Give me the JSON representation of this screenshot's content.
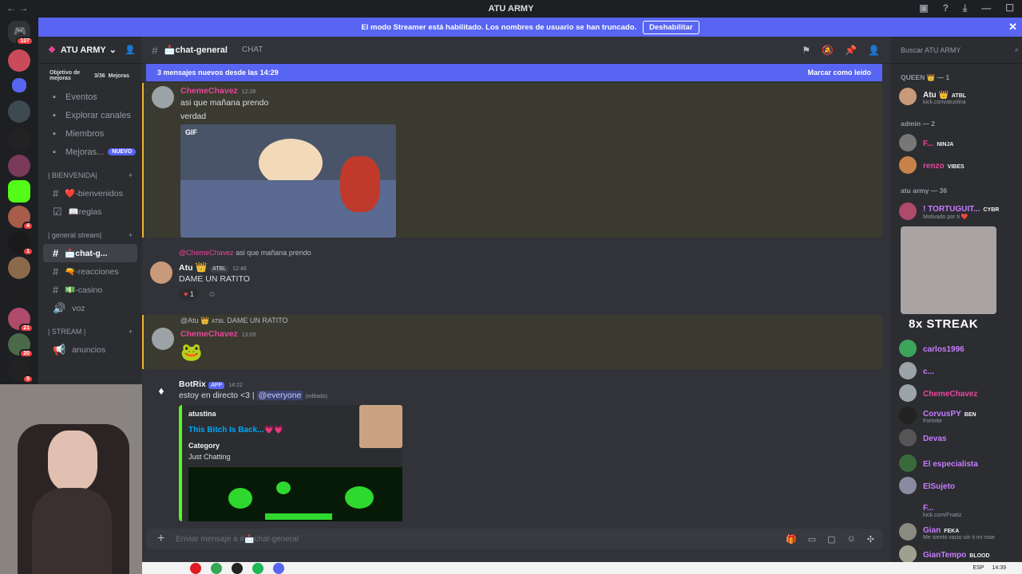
{
  "window": {
    "title": "ATU ARMY"
  },
  "streamer_banner": {
    "text": "El modo Streamer está habilitado. Los nombres de usuario se han truncado.",
    "button": "Deshabilitar"
  },
  "guild_badges": [
    "107",
    "4",
    "1",
    "21",
    "20",
    "5"
  ],
  "server": {
    "name": "ATU ARMY"
  },
  "boost": {
    "label": "Objetivo de mejoras",
    "count": "3/36",
    "unit": "Mejoras"
  },
  "nav": [
    {
      "icon": "calendar-icon",
      "label": "Eventos"
    },
    {
      "icon": "compass-icon",
      "label": "Explorar canales"
    },
    {
      "icon": "members-icon",
      "label": "Miembros"
    },
    {
      "icon": "boost-icon",
      "label": "Mejoras...",
      "badge": "NUEVO"
    }
  ],
  "categories": [
    {
      "name": "| BIENVENIDA|",
      "channels": [
        {
          "prefix": "#",
          "name": "❤️-bienvenidos"
        },
        {
          "prefix": "☑",
          "name": "📖reglas"
        }
      ]
    },
    {
      "name": "| general stream|",
      "channels": [
        {
          "prefix": "#",
          "name": "📩chat-g...",
          "active": true
        },
        {
          "prefix": "#",
          "name": "🔫-reacciones"
        },
        {
          "prefix": "#",
          "name": "💵-casino"
        },
        {
          "prefix": "🔊",
          "name": "voz"
        }
      ]
    },
    {
      "name": "| STREAM |",
      "channels": [
        {
          "prefix": "📢",
          "name": "anuncios"
        }
      ]
    }
  ],
  "chat": {
    "channel": "📩chat-general",
    "topic": "CHAT",
    "new_messages": "3 mensajes nuevos desde las 14:29",
    "mark_read": "Marcar como leído",
    "gif_label": "GIF",
    "composer_placeholder": "Enviar mensaje a #📩chat-general"
  },
  "messages": [
    {
      "author": "ChemeChavez",
      "time": "12:28",
      "lines": [
        "asi que mañana prendo",
        "verdad"
      ]
    },
    {
      "reply_author": "@ChemeChavez",
      "reply_text": "asi que mañana prendo",
      "author": "Atu",
      "tag": "ATBL",
      "time": "12:48",
      "lines": [
        "DAME UN RATITO"
      ],
      "reaction": "1"
    },
    {
      "reply_author": "@Atu",
      "reply_tag": "ATBL",
      "reply_text": "DAME UN RATITO",
      "author": "ChemeChavez",
      "time": "13:09"
    },
    {
      "author": "BotRix",
      "app_tag": "APP",
      "time": "14:22",
      "text": "estoy en directo <3 |",
      "mention": "@everyone",
      "edited": "(editado)"
    }
  ],
  "embed": {
    "author": "atustina",
    "title": "This Bitch Is Back...💗💗",
    "field_name": "Category",
    "field_value": "Just Chatting"
  },
  "members": {
    "search_placeholder": "Buscar ATU ARMY",
    "groups": [
      {
        "label": "QUEEN 👑 — 1"
      },
      {
        "label": "admin — 2"
      },
      {
        "label": "atu army — 36"
      }
    ],
    "list": [
      {
        "name": "Atu 👑",
        "tag": "ATBL",
        "sub": "kick.com/atustina",
        "color": "#f2f3f5"
      },
      {
        "name": "F...",
        "tag": "NINJA",
        "color": "#eb459e"
      },
      {
        "name": "renzo",
        "tag": "VIBES",
        "color": "#eb459e"
      },
      {
        "name": "! TORTUGUIT...",
        "tag": "CYBR",
        "sub": "Motivado por ti ❤️",
        "color": "#c77dff"
      },
      {
        "name": "carlos1996",
        "color": "#c77dff"
      },
      {
        "name": "c...",
        "color": "#c77dff"
      },
      {
        "name": "ChemeChavez",
        "color": "#eb459e"
      },
      {
        "name": "CorvusPY",
        "tag": "BEN",
        "sub": "Fortnite",
        "color": "#c77dff"
      },
      {
        "name": "Devas",
        "color": "#c77dff"
      },
      {
        "name": "El especialista",
        "color": "#c77dff"
      },
      {
        "name": "ElSujeto",
        "color": "#c77dff"
      },
      {
        "name": "F...",
        "sub": "kick.com/Fnatiz",
        "color": "#c77dff"
      },
      {
        "name": "Gian",
        "tag": "FEKA",
        "sub": "Me siento vacio sin ti mi rose",
        "color": "#c77dff"
      },
      {
        "name": "GianTempo",
        "tag": "BLOOD",
        "color": "#c77dff"
      }
    ],
    "overlay": "8x STREAK"
  },
  "taskbar": {
    "lang": "ESP",
    "time": "14:39"
  }
}
